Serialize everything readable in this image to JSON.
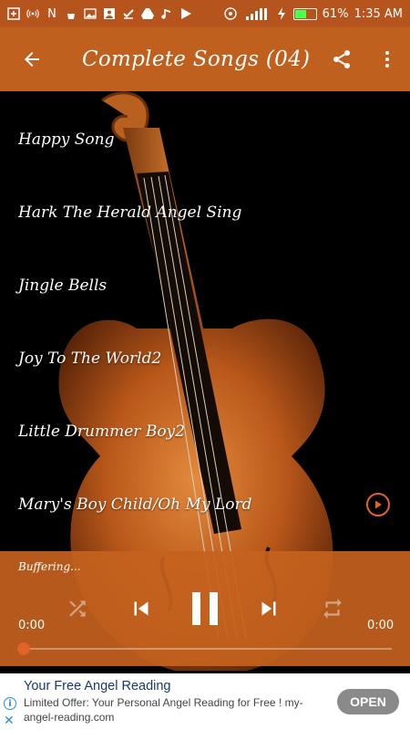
{
  "status_bar": {
    "carrier_indicator": "N",
    "signal_label": "1",
    "battery_percent": "61%",
    "battery_level": 0.61,
    "time": "1:35 AM",
    "icons": [
      "plus-box-icon",
      "hotspot-icon",
      "n-icon",
      "broom-icon",
      "image-icon",
      "account-box-icon",
      "checkmark-icon",
      "drive-icon",
      "music-icon",
      "play-store-icon",
      "wifi-icon",
      "signal-icon",
      "charging-icon",
      "battery-icon"
    ]
  },
  "appbar": {
    "title": "Complete Songs (04)",
    "back_icon": "arrow-left-icon",
    "share_icon": "share-icon",
    "more_icon": "more-vert-icon",
    "background_color": "#c0601f"
  },
  "songs": [
    {
      "title": "Happy Song"
    },
    {
      "title": "Hark The Herald Angel Sing"
    },
    {
      "title": "Jingle Bells"
    },
    {
      "title": "Joy To The World2"
    },
    {
      "title": "Little Drummer Boy2"
    },
    {
      "title": "Mary's Boy Child/Oh My Lord",
      "now_playing": true
    }
  ],
  "player": {
    "status": "Buffering...",
    "current_time": "0:00",
    "total_time": "0:00",
    "progress": 0.0,
    "accent_color": "#e2622a"
  },
  "ad": {
    "headline": "Your Free Angel Reading",
    "body": "Limited Offer: Your Personal Angel Reading for Free ! my-angel-reading.com",
    "cta": "OPEN"
  }
}
